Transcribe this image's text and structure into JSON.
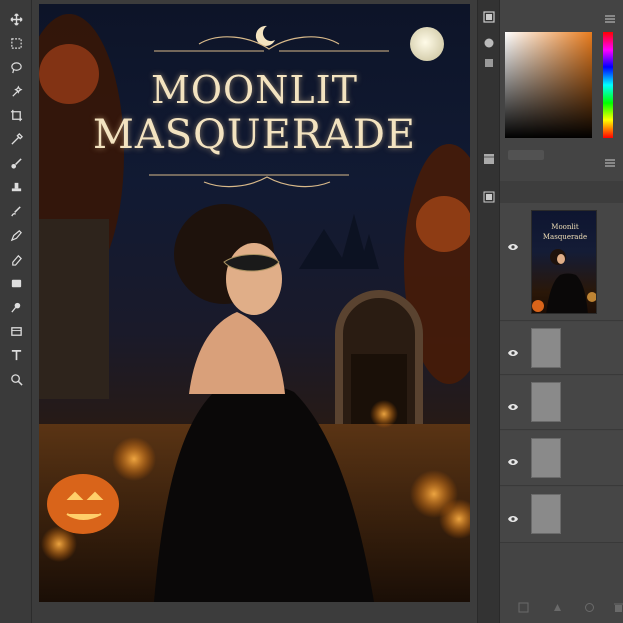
{
  "artwork": {
    "title_line_1": "Moonlit",
    "title_line_2": "Masquerade"
  },
  "layers": {
    "thumbnail_title_line_1": "Moonlit",
    "thumbnail_title_line_2": "Masquerade",
    "visible_rows": 5
  },
  "toolbar": {
    "tools": [
      "move-tool",
      "marquee-tool",
      "lasso-tool",
      "quick-select-tool",
      "crop-tool",
      "eyedropper-tool",
      "brush-tool",
      "clone-stamp-tool",
      "history-brush-tool",
      "eraser-tool",
      "gradient-tool",
      "dodge-tool",
      "pen-tool",
      "text-tool",
      "zoom-tool"
    ]
  },
  "colors": {
    "accent_orange": "#e87c1e",
    "title_cream": "#f3e3c0"
  }
}
